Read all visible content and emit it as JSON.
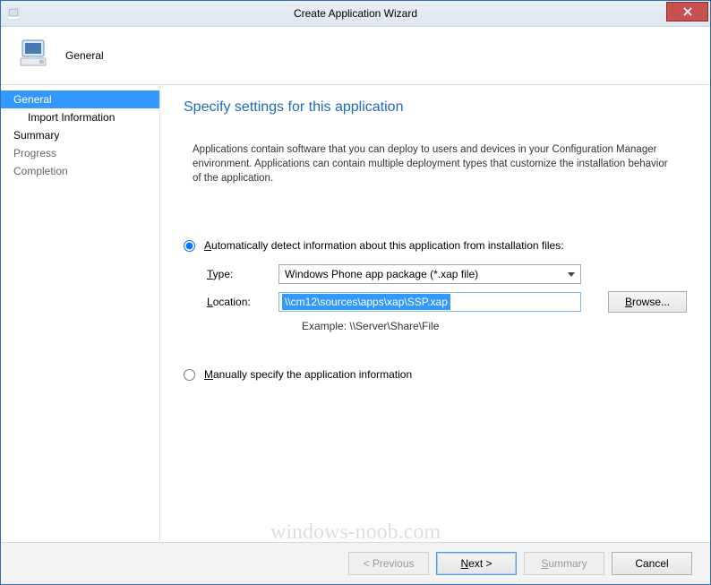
{
  "window": {
    "title": "Create Application Wizard"
  },
  "header": {
    "title": "General"
  },
  "sidebar": {
    "items": [
      {
        "label": "General"
      },
      {
        "label": "Import Information"
      },
      {
        "label": "Summary"
      },
      {
        "label": "Progress"
      },
      {
        "label": "Completion"
      }
    ]
  },
  "content": {
    "title": "Specify settings for this application",
    "description": "Applications contain software that you can deploy to users and devices in your Configuration Manager environment. Applications can contain multiple deployment types that customize the installation behavior of the application.",
    "radio_auto": "utomatically detect information about this application from installation files:",
    "radio_auto_access": "A",
    "type_label_access": "T",
    "type_label": "ype:",
    "type_value": "Windows Phone app package (*.xap file)",
    "location_label_access": "L",
    "location_label": "ocation:",
    "location_value": "\\\\cm12\\sources\\apps\\xap\\SSP.xap",
    "browse_access": "B",
    "browse": "rowse...",
    "example": "Example: \\\\Server\\Share\\File",
    "radio_manual_access": "M",
    "radio_manual": "anually specify the application information"
  },
  "footer": {
    "previous": "< Previous",
    "next_access": "N",
    "next": "ext >",
    "summary_access": "S",
    "summary": "ummary",
    "cancel": "Cancel"
  },
  "watermark": "windows-noob.com"
}
